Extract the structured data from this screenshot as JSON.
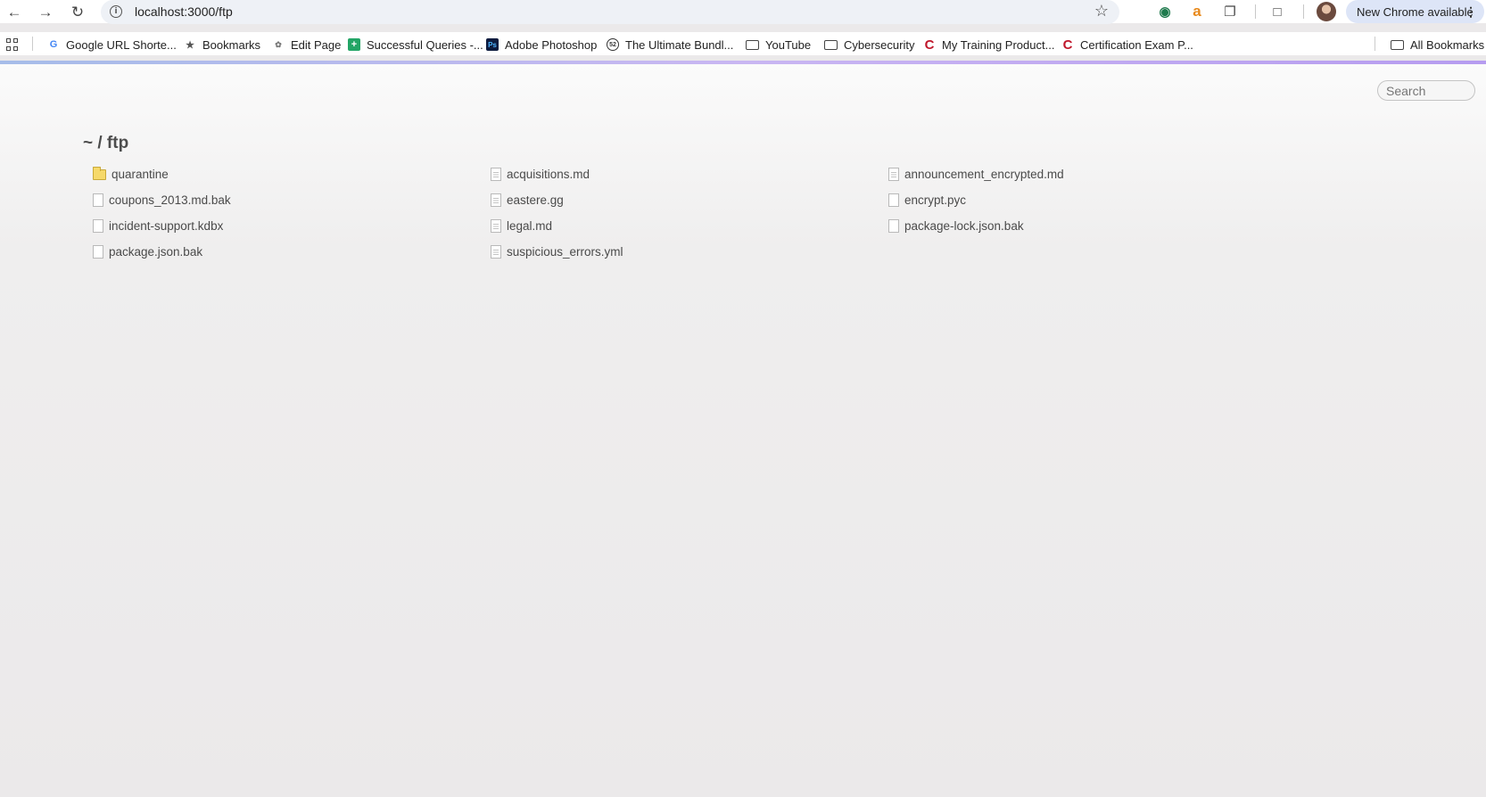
{
  "browser": {
    "url": "localhost:3000/ftp",
    "update_label": "New Chrome available",
    "bookmarks": [
      {
        "label": "Google URL Shorte...",
        "icon": "google-icon"
      },
      {
        "label": "Bookmarks",
        "icon": "star-icon"
      },
      {
        "label": "Edit Page",
        "icon": "person-icon"
      },
      {
        "label": "Successful Queries -...",
        "icon": "sheets-icon"
      },
      {
        "label": "Adobe Photoshop",
        "icon": "photoshop-icon"
      },
      {
        "label": "The Ultimate Bundl...",
        "icon": "bundle-icon"
      },
      {
        "label": "YouTube",
        "icon": "folder-icon"
      },
      {
        "label": "Cybersecurity",
        "icon": "folder-icon"
      },
      {
        "label": "My Training Product...",
        "icon": "c-logo-icon"
      },
      {
        "label": "Certification Exam P...",
        "icon": "c-logo-icon"
      }
    ],
    "all_bookmarks": "All Bookmarks"
  },
  "page": {
    "search_placeholder": "Search",
    "breadcrumb": "~ / ftp",
    "files": [
      {
        "name": "quarantine",
        "type": "folder"
      },
      {
        "name": "acquisitions.md",
        "type": "text-file"
      },
      {
        "name": "announcement_encrypted.md",
        "type": "text-file"
      },
      {
        "name": "coupons_2013.md.bak",
        "type": "file"
      },
      {
        "name": "eastere.gg",
        "type": "text-file"
      },
      {
        "name": "encrypt.pyc",
        "type": "file"
      },
      {
        "name": "incident-support.kdbx",
        "type": "file"
      },
      {
        "name": "legal.md",
        "type": "text-file"
      },
      {
        "name": "package-lock.json.bak",
        "type": "file"
      },
      {
        "name": "package.json.bak",
        "type": "file"
      },
      {
        "name": "suspicious_errors.yml",
        "type": "text-file"
      }
    ]
  }
}
